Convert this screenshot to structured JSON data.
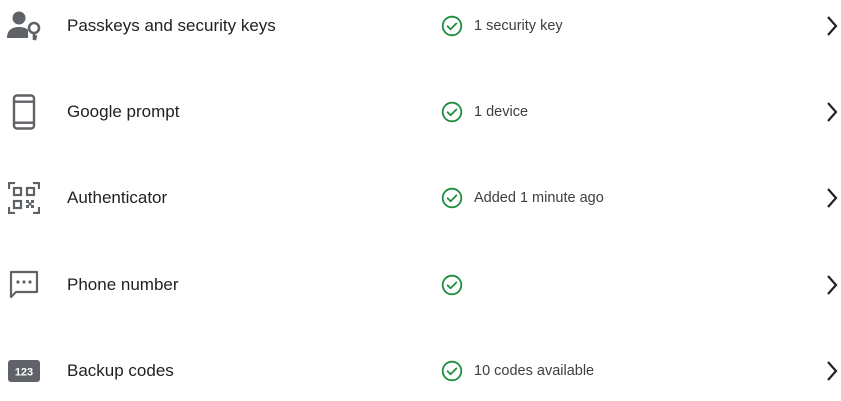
{
  "colors": {
    "icon": "#5f6368",
    "check": "#1e8e3e",
    "text": "#202124",
    "secondary": "#3c4043"
  },
  "methods": [
    {
      "label": "Passkeys and security keys",
      "icon": "person-key-icon",
      "status": "1 security key"
    },
    {
      "label": "Google prompt",
      "icon": "phone-icon",
      "status": "1 device"
    },
    {
      "label": "Authenticator",
      "icon": "qr-code-icon",
      "status": "Added 1 minute ago"
    },
    {
      "label": "Phone number",
      "icon": "sms-icon",
      "status": ""
    },
    {
      "label": "Backup codes",
      "icon": "backup-codes-icon",
      "icon_text": "123",
      "status": "10 codes available"
    }
  ]
}
